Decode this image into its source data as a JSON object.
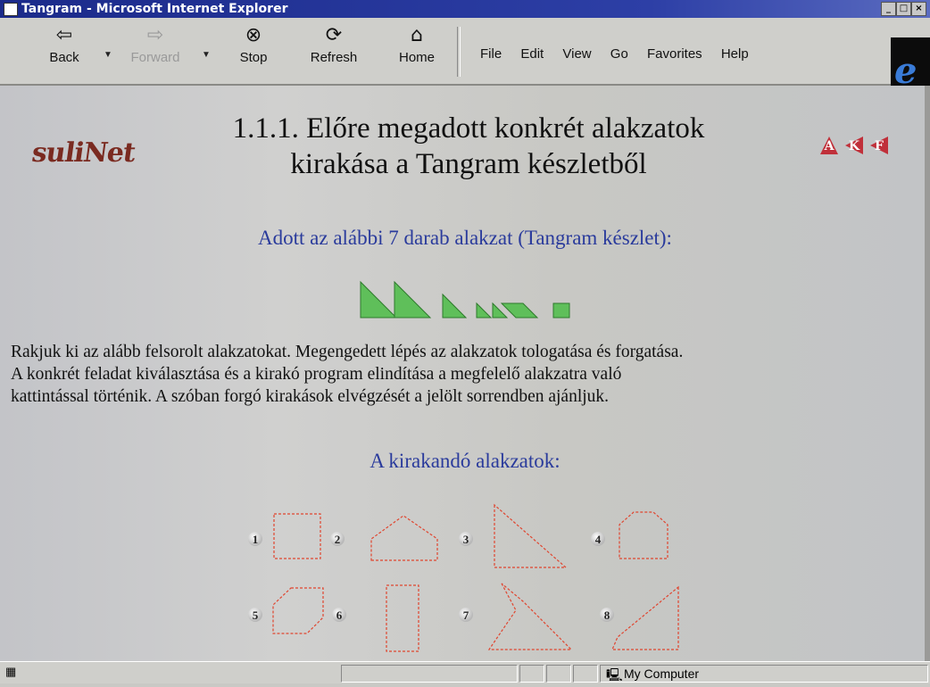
{
  "window": {
    "title": "Tangram - Microsoft Internet Explorer"
  },
  "toolbar": {
    "back": "Back",
    "forward": "Forward",
    "stop": "Stop",
    "refresh": "Refresh",
    "home": "Home"
  },
  "menu": [
    "File",
    "Edit",
    "View",
    "Go",
    "Favorites",
    "Help"
  ],
  "page": {
    "logo": "suliNet",
    "heading_line1": "1.1.1. Előre megadott konkrét alakzatok",
    "heading_line2": "kirakása a Tangram készletből",
    "nav_icons": [
      "A",
      "K",
      "F"
    ],
    "subtitle": "Adott az alábbi 7 darab alakzat (Tangram készlet):",
    "paragraph": [
      "Rakjuk ki az alább felsorolt alakzatokat. Megengedett lépés az alakzatok tologatása és forgatása.",
      "A konkrét feladat kiválasztása és a kirakó program elindítása a megfelelő alakzatra való",
      "kattintással történik. A szóban forgó kirakások elvégzését a jelölt sorrendben ajánljuk."
    ],
    "shapes_header": "A kirakandó alakzatok:",
    "shape_numbers": [
      "1",
      "2",
      "3",
      "4",
      "5",
      "6",
      "7",
      "8"
    ]
  },
  "status": {
    "zone": "My Computer"
  },
  "colors": {
    "piece_fill": "#5fbf5a",
    "outline": "#e0452f",
    "heading_blue": "#2a3b9c"
  }
}
